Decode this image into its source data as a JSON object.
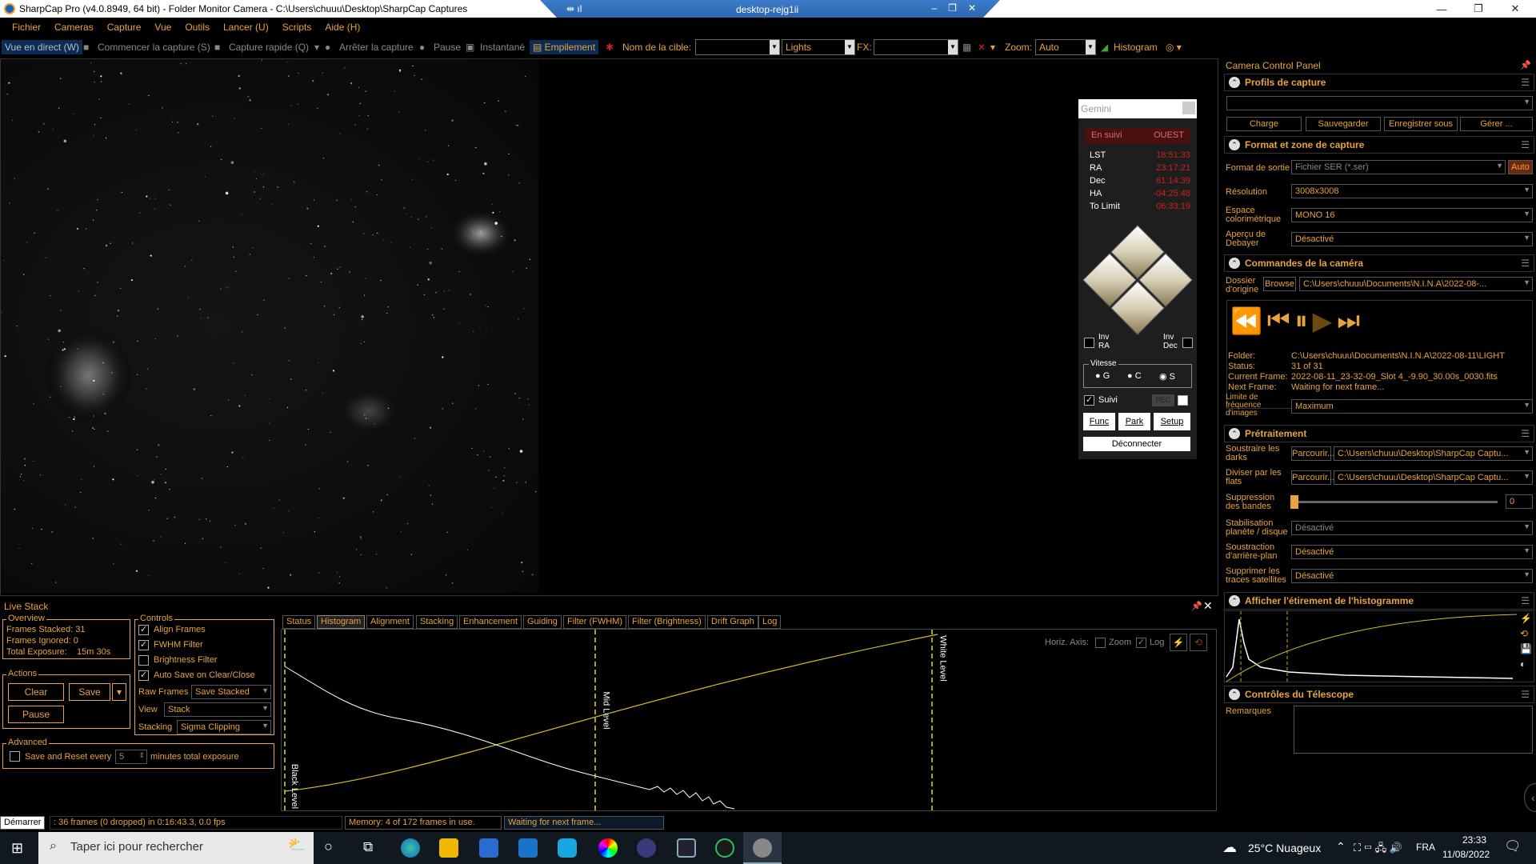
{
  "window": {
    "title": "SharpCap Pro (v4.0.8949, 64 bit) - Folder Monitor Camera - C:\\Users\\chuuu\\Desktop\\SharpCap Captures",
    "remote_title": "desktop-rejg1ii"
  },
  "menu": [
    "Fichier",
    "Cameras",
    "Capture",
    "Vue",
    "Outils",
    "Lancer (U)",
    "Scripts",
    "Aide (H)"
  ],
  "toolbar": {
    "live_view": "Vue en direct (W)",
    "start_capture": "Commencer la capture (S)",
    "quick_capture": "Capture rapide (Q)",
    "stop_capture": "Arrêter la capture",
    "pause": "Pause",
    "snapshot": "Instantané",
    "stacking": "Empilement",
    "target_label": "Nom de la cible:",
    "target_value": "",
    "frame_type": "Lights",
    "fx_label": "FX:",
    "fx_value": "",
    "zoom_label": "Zoom:",
    "zoom_value": "Auto",
    "histogram": "Histogram"
  },
  "gemini": {
    "title": "Gemini",
    "tracking": "En suivi",
    "side": "OUEST",
    "rows": [
      {
        "k": "LST",
        "v": "18:51:33"
      },
      {
        "k": "RA",
        "v": "23:17:21"
      },
      {
        "k": "Dec",
        "v": "61:14:39"
      },
      {
        "k": "HA",
        "v": "-04:25:48"
      },
      {
        "k": "To Limit",
        "v": "06:33:19"
      }
    ],
    "inv_ra": "Inv\nRA",
    "inv_dec": "Inv\nDec",
    "speed": "Vitesse",
    "speeds": [
      "G",
      "C",
      "S"
    ],
    "suivi": "Suivi",
    "pec": "PEC",
    "func": "Func",
    "park": "Park",
    "setup": "Setup",
    "disconnect": "Déconnecter"
  },
  "ccp": {
    "title": "Camera Control Panel",
    "profiles": {
      "title": "Profils de capture",
      "load": "Charge",
      "save": "Sauvegarder",
      "save_as": "Enregistrer sous",
      "manage": "Gérer ..."
    },
    "format": {
      "title": "Format et zone de capture",
      "output_label": "Format de sortie",
      "output_value": "Fichier SER (*.ser)",
      "auto": "Auto",
      "res_label": "Résolution",
      "res_value": "3008x3008",
      "color_label": "Espace colorimétrique",
      "color_value": "MONO 16",
      "debayer_label": "Aperçu de Debayer",
      "debayer_value": "Désactivé"
    },
    "camera": {
      "title": "Commandes de la caméra",
      "folder_label": "Dossier d'origine",
      "browse": "Browse",
      "folder_value": "C:\\Users\\chuuu\\Documents\\N.I.N.A\\2022-08-...",
      "folder_k": "Folder:",
      "folder_v": "C:\\Users\\chuuu\\Documents\\N.I.N.A\\2022-08-11\\LIGHT",
      "status_k": "Status:",
      "status_v": "31 of 31",
      "current_k": "Current Frame:",
      "current_v": "2022-08-11_23-32-09_Slot 4_-9.90_30.00s_0030.fits",
      "next_k": "Next Frame:",
      "next_v": "Waiting for next frame...",
      "rate_label": "Limite de fréquence d'images",
      "rate_value": "Maximum"
    },
    "pre": {
      "title": "Prétraitement",
      "darks_label": "Soustraire les darks",
      "flats_label": "Diviser par les flats",
      "browse": "Parcourir...",
      "darks_value": "C:\\Users\\chuuu\\Desktop\\SharpCap Captu...",
      "flats_value": "C:\\Users\\chuuu\\Desktop\\SharpCap Captu...",
      "banding_label": "Suppression des bandes",
      "banding_value": "0",
      "stab_label": "Stabilisation planète / disque",
      "stab_value": "Désactivé",
      "bg_label": "Soustraction d'arrière-plan",
      "bg_value": "Désactivé",
      "sat_label": "Supprimer les traces satellites",
      "sat_value": "Désactivé"
    },
    "hist_title": "Afficher l'étirement de l'histogramme",
    "scope": {
      "title": "Contrôles du Télescope",
      "notes": "Remarques"
    }
  },
  "live_stack": {
    "title": "Live Stack",
    "overview": {
      "title": "Overview",
      "stacked": "Frames Stacked: 31",
      "ignored": "Frames Ignored:  0",
      "exposure_k": "Total Exposure:",
      "exposure_v": "15m 30s"
    },
    "actions": {
      "title": "Actions",
      "clear": "Clear",
      "save": "Save",
      "pause": "Pause"
    },
    "advanced": {
      "title": "Advanced",
      "save_reset": "Save and Reset every",
      "minutes": "5",
      "minutes_label": "minutes total exposure"
    },
    "controls": {
      "title": "Controls",
      "align": "Align Frames",
      "fwhm": "FWHM Filter",
      "brightness": "Brightness Filter",
      "autosave": "Auto Save on Clear/Close",
      "raw_label": "Raw Frames",
      "raw_value": "Save Stacked",
      "view_label": "View",
      "view_value": "Stack",
      "stack_label": "Stacking",
      "stack_value": "Sigma Clipping"
    },
    "tabs": [
      "Status",
      "Histogram",
      "Alignment",
      "Stacking",
      "Enhancement",
      "Guiding",
      "Filter (FWHM)",
      "Filter (Brightness)",
      "Drift Graph",
      "Log"
    ],
    "hist": {
      "horiz_axis": "Horiz. Axis:",
      "zoom": "Zoom",
      "log": "Log",
      "black": "Black Level",
      "mid": "Mid Level",
      "white": "White Level"
    }
  },
  "status": {
    "start": "Démarrer",
    "frames": ": 36 frames (0 dropped) in 0:16:43.3, 0.0 fps",
    "memory": "Memory: 4 of 172 frames in use.",
    "waiting": "Waiting for next frame..."
  },
  "taskbar": {
    "search": "Taper ici pour rechercher",
    "weather": "25°C  Nuageux",
    "lang": "FRA",
    "time": "23:33",
    "date": "11/08/2022"
  },
  "colors": {
    "accent": "#e8a33d",
    "red_value": "#d01f1f"
  }
}
